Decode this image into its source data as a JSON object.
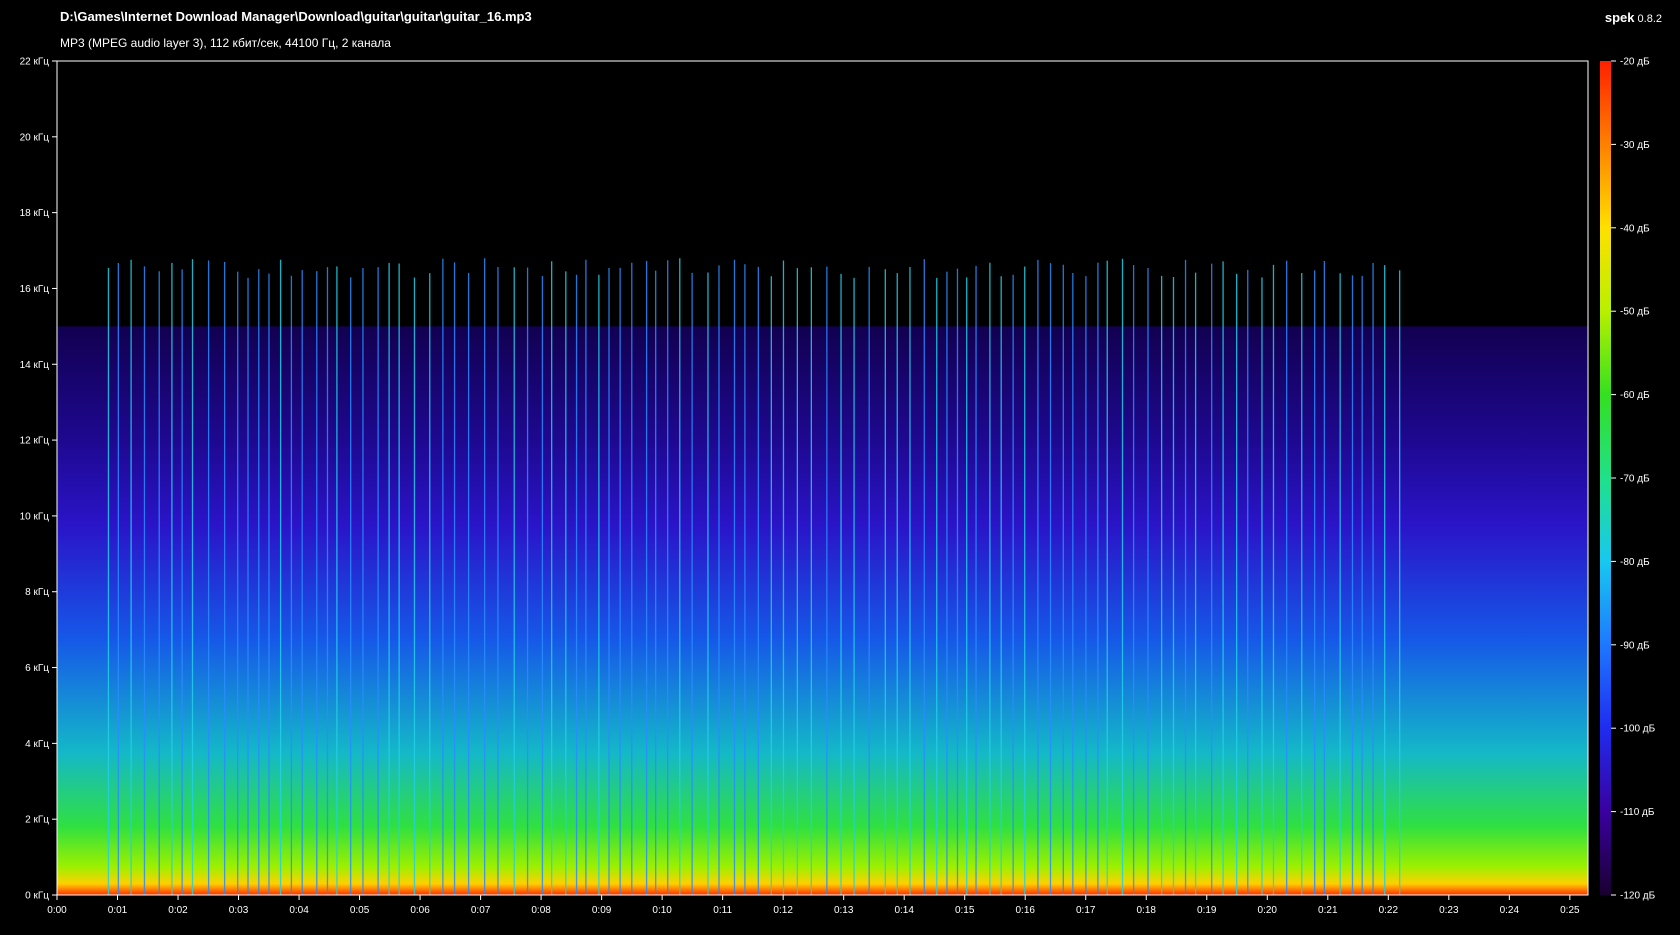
{
  "header": {
    "file_path": "D:\\Games\\Internet Download Manager\\Download\\guitar\\guitar\\guitar_16.mp3",
    "file_info": "MP3 (MPEG audio layer 3), 112 кбит/сек, 44100 Гц, 2 канала",
    "app_name": "spek",
    "app_version": "0.8.2"
  },
  "chart_data": {
    "type": "heatmap",
    "frequency_ticks": [
      "0 кГц",
      "2 кГц",
      "4 кГц",
      "6 кГц",
      "8 кГц",
      "10 кГц",
      "12 кГц",
      "14 кГц",
      "16 кГц",
      "18 кГц",
      "20 кГц",
      "22 кГц"
    ],
    "frequency_range_khz": [
      0,
      22
    ],
    "time_ticks": [
      "0:00",
      "0:01",
      "0:02",
      "0:03",
      "0:04",
      "0:05",
      "0:06",
      "0:07",
      "0:08",
      "0:09",
      "0:10",
      "0:11",
      "0:12",
      "0:13",
      "0:14",
      "0:15",
      "0:16",
      "0:17",
      "0:18",
      "0:19",
      "0:20",
      "0:21",
      "0:22",
      "0:23",
      "0:24",
      "0:25"
    ],
    "time_range_s": [
      0,
      25.3
    ],
    "db_ticks": [
      "-20 дБ",
      "-30 дБ",
      "-40 дБ",
      "-50 дБ",
      "-60 дБ",
      "-70 дБ",
      "-80 дБ",
      "-90 дБ",
      "-100 дБ",
      "-110 дБ",
      "-120 дБ"
    ],
    "db_range": [
      -120,
      -20
    ],
    "spectral_cutoff_khz": 15.0,
    "transient_peak_khz": 16.8,
    "colors": {
      "background": "#000000",
      "frame": "#ffffff",
      "scale": [
        "#1a0030",
        "#3a00a0",
        "#1f2cf0",
        "#1e78ff",
        "#18c8f0",
        "#20e08a",
        "#34e020",
        "#b8f000",
        "#ffe000",
        "#ff8000",
        "#ff2000"
      ]
    }
  }
}
